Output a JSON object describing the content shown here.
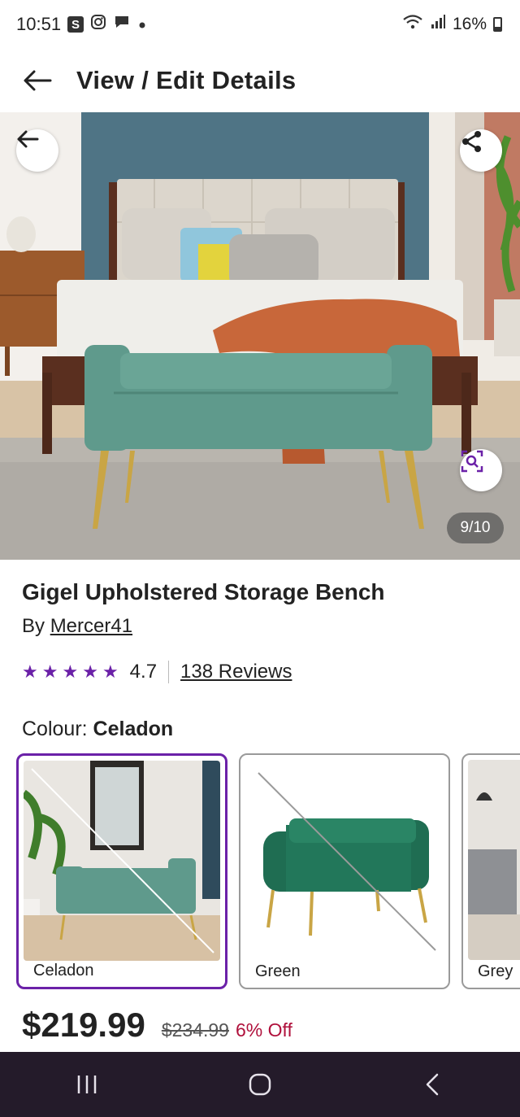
{
  "status_bar": {
    "time": "10:51",
    "app_icons": [
      "S",
      "instagram-icon",
      "chat-icon"
    ],
    "battery": "16%"
  },
  "header": {
    "title": "View / Edit Details"
  },
  "gallery": {
    "counter": "9/10"
  },
  "product": {
    "title": "Gigel Upholstered Storage Bench",
    "by_prefix": "By",
    "brand": "Mercer41",
    "rating": "4.7",
    "stars": 5,
    "reviews": "138 Reviews",
    "colour_label": "Colour:",
    "colour_value": "Celadon",
    "swatches": [
      {
        "label": "Celadon",
        "selected": true
      },
      {
        "label": "Green",
        "selected": false
      },
      {
        "label": "Grey",
        "selected": false
      }
    ],
    "price": "$219.99",
    "was_price": "$234.99",
    "discount": "6% Off"
  },
  "colors": {
    "accent": "#6b21a8",
    "discount": "#b0113c",
    "bench": "#5f9a8c",
    "nav_bg": "#241b2a"
  }
}
